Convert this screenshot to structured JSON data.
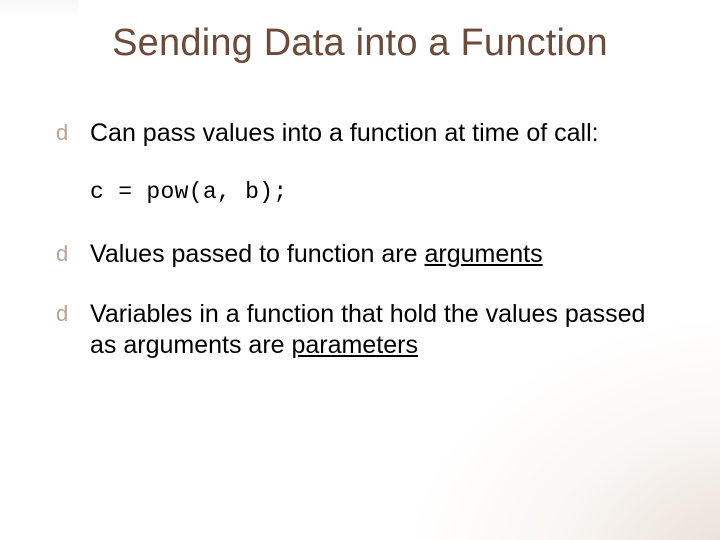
{
  "title": "Sending Data into a Function",
  "bullets": {
    "b1": {
      "text": "Can pass values into a function at time of call:"
    },
    "code": "c = pow(a, b);",
    "b2": {
      "pre": "Values passed to function are ",
      "u1": "arguments"
    },
    "b3": {
      "pre": "Variables in a function that hold the values passed as arguments are ",
      "u1": "parameters"
    }
  },
  "icons": {
    "bullet_glyph": "d"
  }
}
